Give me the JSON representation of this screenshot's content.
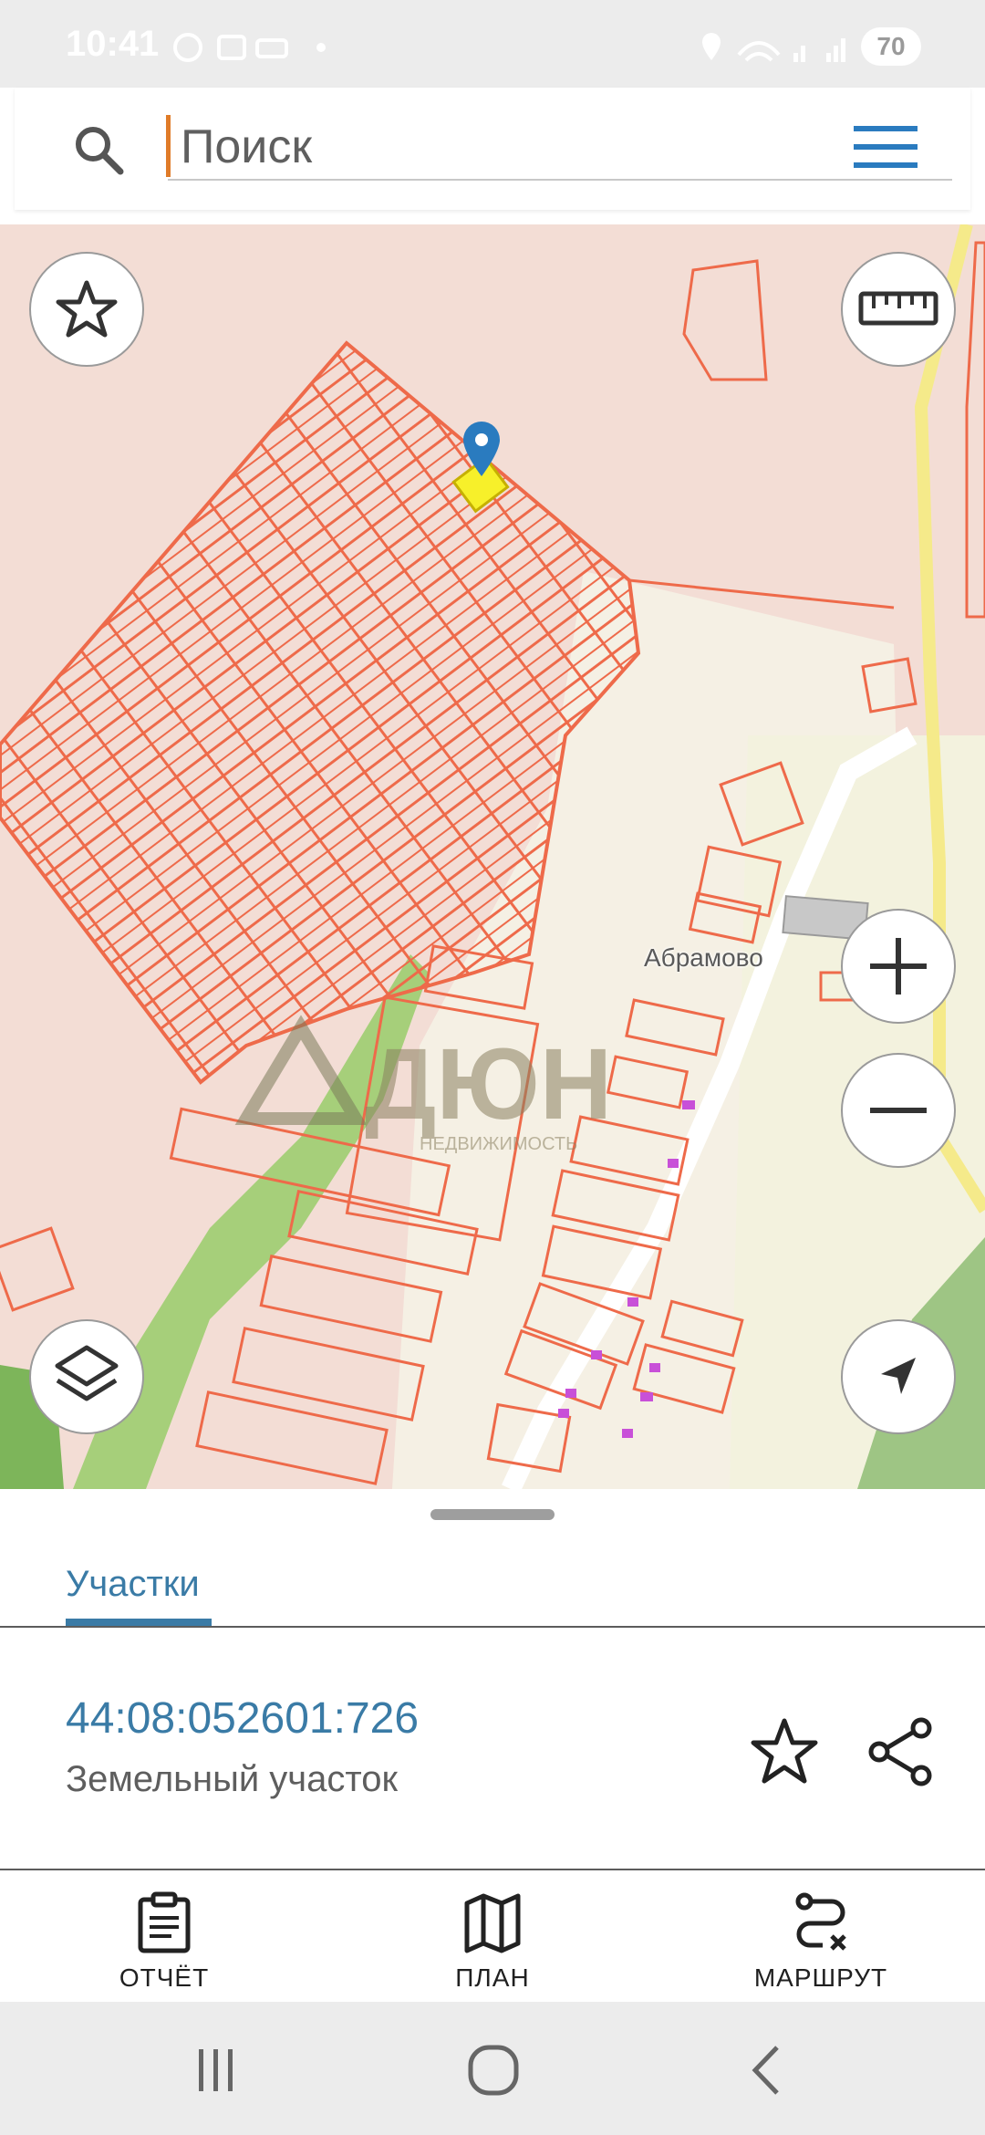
{
  "status_bar": {
    "time": "10:41",
    "battery": "70"
  },
  "search": {
    "placeholder": "Поиск",
    "icon": "search-icon",
    "menu_icon": "hamburger-menu-icon"
  },
  "map": {
    "village_label": "Абрамово",
    "watermark_brand": "ДЮН",
    "watermark_sub": "НЕДВИЖИМОСТЬ",
    "controls": [
      "star-icon",
      "ruler-icon",
      "layers-icon",
      "zoom-in-icon",
      "zoom-out-icon",
      "navigation-arrow-icon"
    ],
    "colors": {
      "parcel_outline": "#ee6a4a",
      "map_background": "#f3ddd5",
      "road": "#f5ea8a",
      "green_area": "#a6cf7a",
      "selected_parcel": "#f7f02a",
      "pin": "#2a7bbf"
    }
  },
  "sheet": {
    "tab": "Участки",
    "parcel_number": "44:08:052601:726",
    "parcel_type": "Земельный участок",
    "actions": [
      {
        "label": "ОТЧЁТ",
        "icon": "clipboard-icon"
      },
      {
        "label": "ПЛАН",
        "icon": "map-icon"
      },
      {
        "label": "МАРШРУТ",
        "icon": "route-icon"
      }
    ],
    "accent": "#3a7ba6"
  },
  "nav_bar": {
    "buttons": [
      "recent-apps-icon",
      "home-icon",
      "back-icon"
    ]
  }
}
